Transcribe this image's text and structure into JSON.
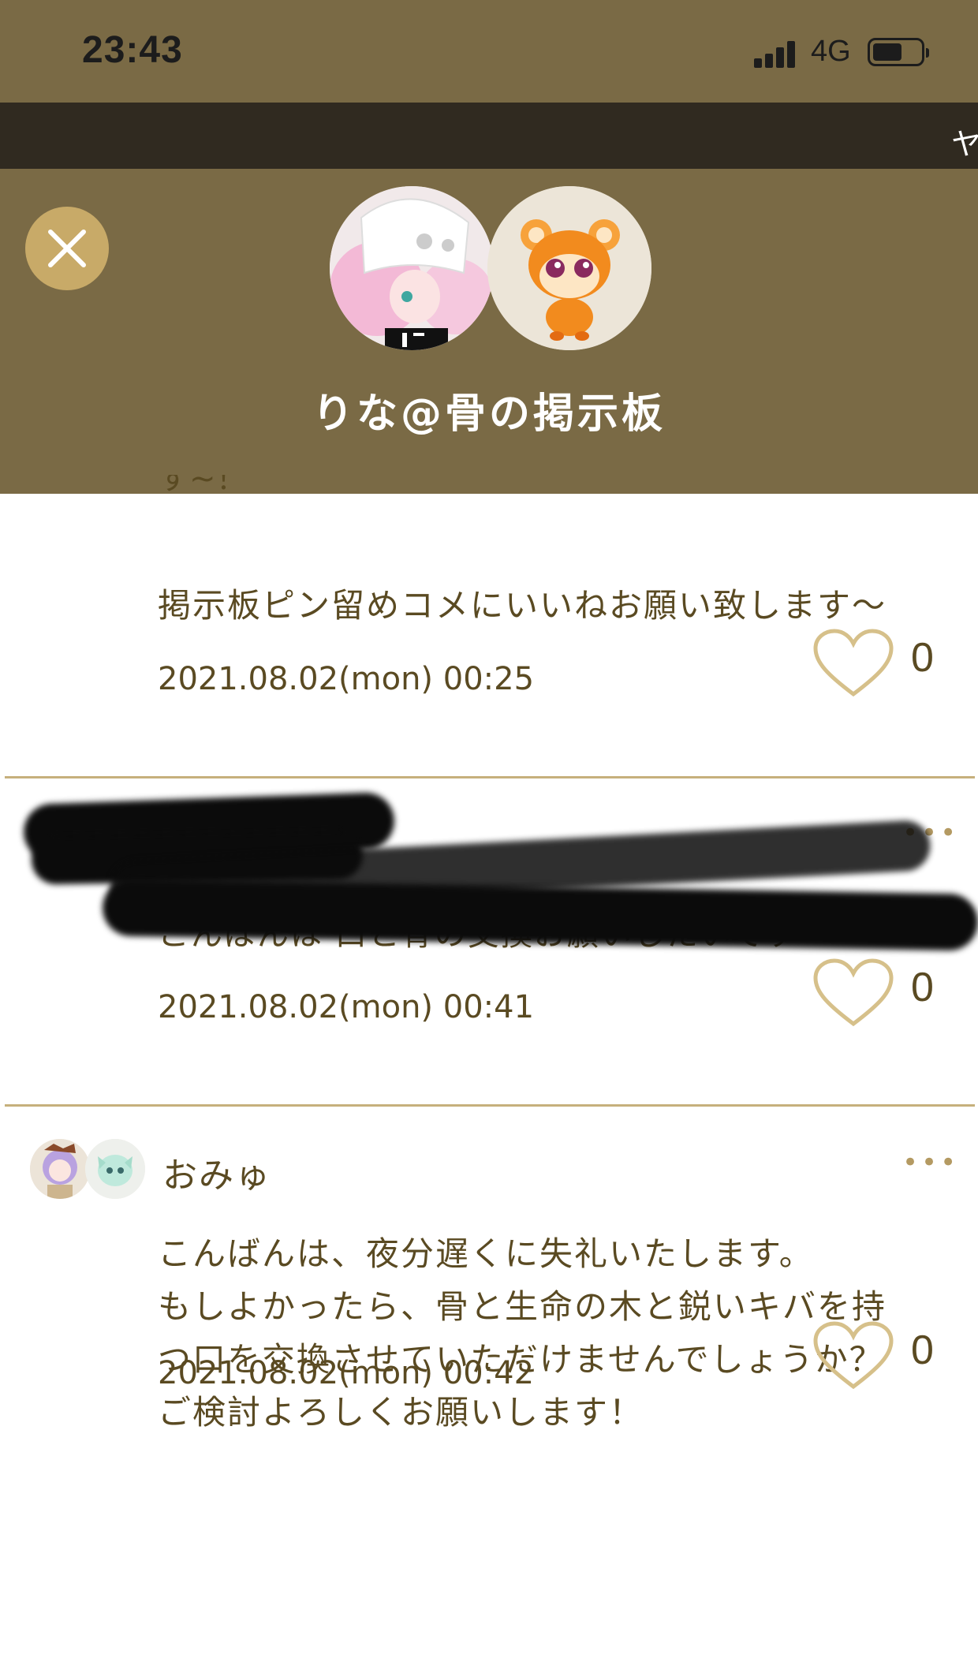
{
  "status_bar": {
    "time": "23:43",
    "network": "4G",
    "icons": [
      "signal-icon",
      "battery-icon"
    ]
  },
  "top_strip": {
    "edge_text": "ヤ"
  },
  "header": {
    "title": "りな@骨の掲示板",
    "close_icon": "close-icon",
    "colors": {
      "header_bg": "#7a6a45",
      "close_bg": "#c8aa68",
      "accent": "#c6b07c"
    }
  },
  "posts": [
    {
      "partial_top_text": "す~！",
      "text": "掲示板ピン留めコメにいいねお願い致します～",
      "timestamp": "2021.08.02(mon) 00:25",
      "likes": "0"
    },
    {
      "redacted": true,
      "text": "こんばんは 口と骨の交換お願いしたいです",
      "timestamp": "2021.08.02(mon) 00:41",
      "likes": "0",
      "more": "•••"
    },
    {
      "username": "おみゅ",
      "text": "こんばんは、夜分遅くに失礼いたします。\nもしよかったら、骨と生命の木と鋭いキバを持\nつ口を交換させていただけませんでしょうか？\nご検討よろしくお願いします！",
      "timestamp": "2021.08.02(mon) 00:42",
      "likes": "0",
      "more": "•••"
    }
  ]
}
